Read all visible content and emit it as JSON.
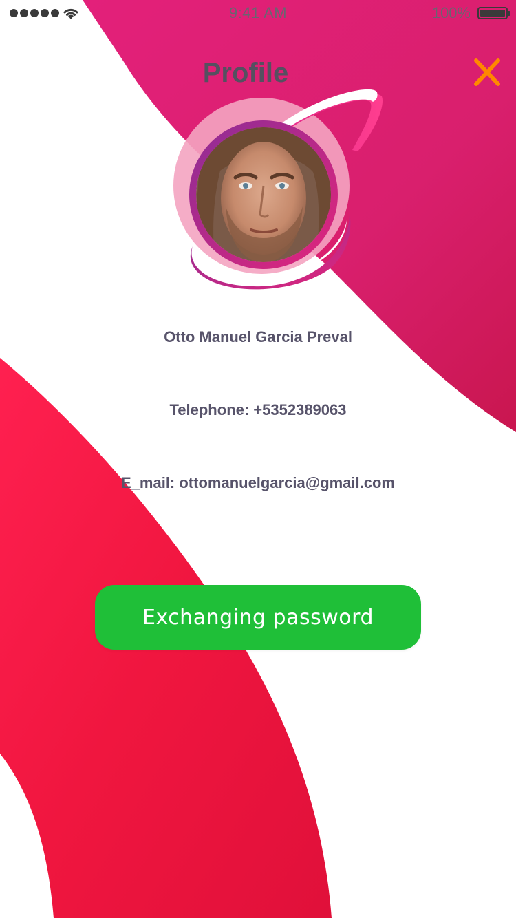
{
  "status_bar": {
    "time": "9:41 AM",
    "battery_percent": "100%",
    "signal_icon": "signal-dots-icon",
    "wifi_icon": "wifi-icon",
    "battery_icon": "battery-icon"
  },
  "header": {
    "title": "Profile",
    "close_icon": "close-icon"
  },
  "profile": {
    "name": "Otto Manuel Garcia Preval",
    "telephone": "Telephone: +5352389063",
    "email": "E_mail: ottomanuelgarcia@gmail.com",
    "avatar": "profile-avatar-photo"
  },
  "actions": {
    "exchange_password_label": "Exchanging password"
  },
  "colors": {
    "accent_pink": "#d91f73",
    "accent_red": "#f0163f",
    "close_orange": "#ff8800",
    "button_green": "#1fbf38",
    "text_dark": "#57536a"
  }
}
